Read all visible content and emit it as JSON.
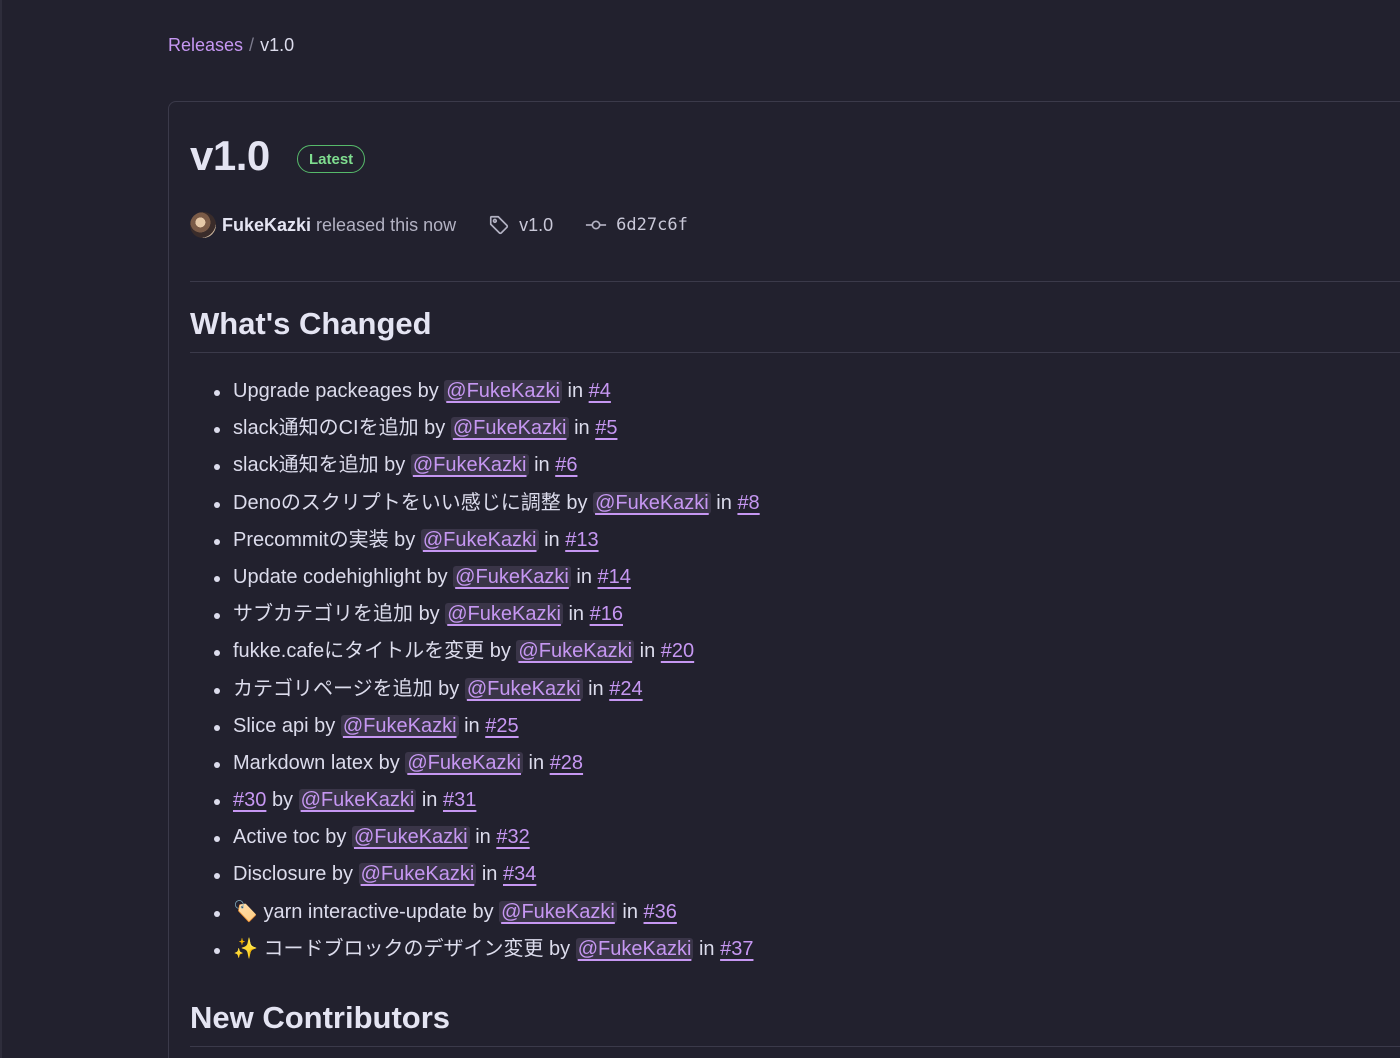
{
  "breadcrumb": {
    "releases_label": "Releases",
    "separator": "/",
    "current": "v1.0"
  },
  "release": {
    "title": "v1.0",
    "badge": "Latest",
    "author": "FukeKazki",
    "released_text": "released this now",
    "tag": "v1.0",
    "commit": "6d27c6f"
  },
  "whats_changed": {
    "heading": "What's Changed",
    "items": [
      {
        "prefix_link": "",
        "title": "Upgrade packeages",
        "by": "by",
        "mention": "@FukeKazki",
        "in": "in",
        "issue": "#4"
      },
      {
        "prefix_link": "",
        "title": "slack通知のCIを追加",
        "by": "by",
        "mention": "@FukeKazki",
        "in": "in",
        "issue": "#5"
      },
      {
        "prefix_link": "",
        "title": "slack通知を追加",
        "by": "by",
        "mention": "@FukeKazki",
        "in": "in",
        "issue": "#6"
      },
      {
        "prefix_link": "",
        "title": "Denoのスクリプトをいい感じに調整",
        "by": "by",
        "mention": "@FukeKazki",
        "in": "in",
        "issue": "#8"
      },
      {
        "prefix_link": "",
        "title": "Precommitの実装",
        "by": "by",
        "mention": "@FukeKazki",
        "in": "in",
        "issue": "#13"
      },
      {
        "prefix_link": "",
        "title": "Update codehighlight",
        "by": "by",
        "mention": "@FukeKazki",
        "in": "in",
        "issue": "#14"
      },
      {
        "prefix_link": "",
        "title": "サブカテゴリを追加",
        "by": "by",
        "mention": "@FukeKazki",
        "in": "in",
        "issue": "#16"
      },
      {
        "prefix_link": "",
        "title": "fukke.cafeにタイトルを変更",
        "by": "by",
        "mention": "@FukeKazki",
        "in": "in",
        "issue": "#20"
      },
      {
        "prefix_link": "",
        "title": "カテゴリページを追加",
        "by": "by",
        "mention": "@FukeKazki",
        "in": "in",
        "issue": "#24"
      },
      {
        "prefix_link": "",
        "title": "Slice api",
        "by": "by",
        "mention": "@FukeKazki",
        "in": "in",
        "issue": "#25"
      },
      {
        "prefix_link": "",
        "title": "Markdown latex",
        "by": "by",
        "mention": "@FukeKazki",
        "in": "in",
        "issue": "#28"
      },
      {
        "prefix_link": "#30",
        "title": "",
        "by": "by",
        "mention": "@FukeKazki",
        "in": "in",
        "issue": "#31"
      },
      {
        "prefix_link": "",
        "title": "Active toc",
        "by": "by",
        "mention": "@FukeKazki",
        "in": "in",
        "issue": "#32"
      },
      {
        "prefix_link": "",
        "title": "Disclosure",
        "by": "by",
        "mention": "@FukeKazki",
        "in": "in",
        "issue": "#34"
      },
      {
        "prefix_link": "",
        "title": "🏷️ yarn interactive-update",
        "by": "by",
        "mention": "@FukeKazki",
        "in": "in",
        "issue": "#36"
      },
      {
        "prefix_link": "",
        "title": "✨ コードブロックのデザイン変更",
        "by": "by",
        "mention": "@FukeKazki",
        "in": "in",
        "issue": "#37"
      }
    ]
  },
  "new_contributors": {
    "heading": "New Contributors"
  },
  "colors": {
    "background": "#22212e",
    "link": "#c697f2",
    "badge": "#56b96a"
  },
  "icons": {
    "tag": "tag-icon",
    "commit": "git-commit-icon",
    "avatar": "avatar"
  }
}
